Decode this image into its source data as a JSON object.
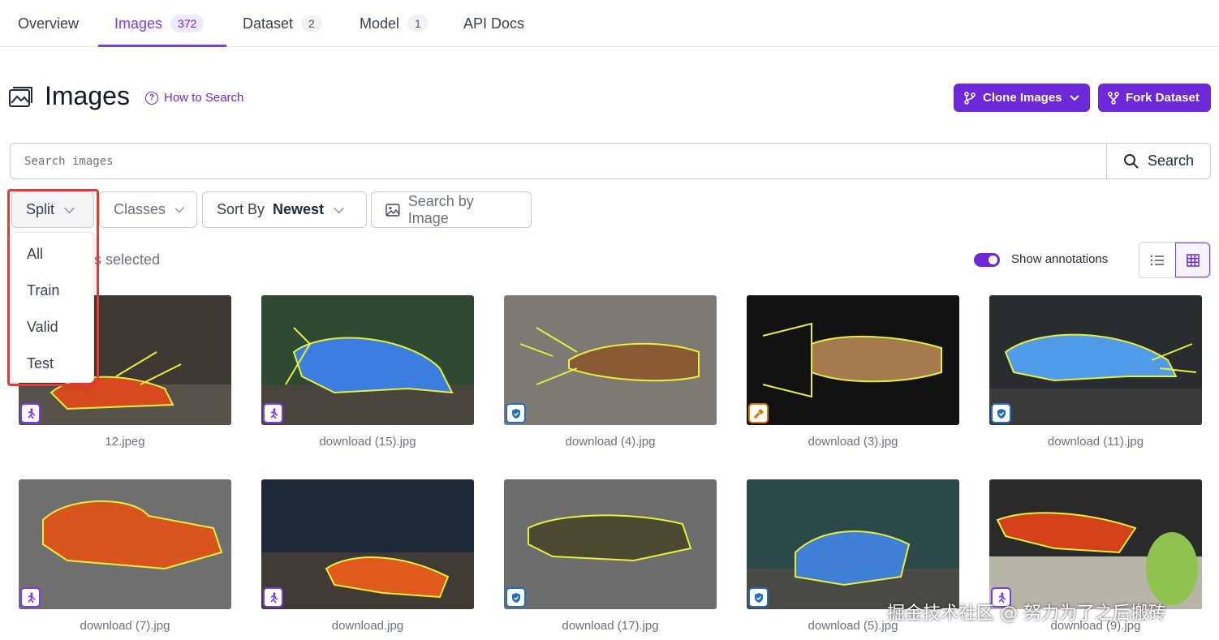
{
  "tabs": [
    {
      "label": "Overview",
      "count": ""
    },
    {
      "label": "Images",
      "count": "372"
    },
    {
      "label": "Dataset",
      "count": "2"
    },
    {
      "label": "Model",
      "count": "1"
    },
    {
      "label": "API Docs",
      "count": ""
    }
  ],
  "header": {
    "title": "Images",
    "how_to_search": "How to Search",
    "clone_label": "Clone Images",
    "fork_label": "Fork Dataset"
  },
  "search": {
    "placeholder": "Search images",
    "button_label": "Search"
  },
  "filters": {
    "split_label": "Split",
    "classes_label": "Classes",
    "sort_label": "Sort By",
    "sort_value": "Newest",
    "search_by_image": "Search by Image"
  },
  "split_dropdown": {
    "options": [
      "All",
      "Train",
      "Valid",
      "Test"
    ]
  },
  "selection": {
    "text": "s selected"
  },
  "view": {
    "annotations_label": "Show annotations"
  },
  "images": [
    {
      "filename": "12.jpeg",
      "split": "train"
    },
    {
      "filename": "download (15).jpg",
      "split": "train"
    },
    {
      "filename": "download (4).jpg",
      "split": "valid"
    },
    {
      "filename": "download (3).jpg",
      "split": "test"
    },
    {
      "filename": "download (11).jpg",
      "split": "valid"
    },
    {
      "filename": "download (7).jpg",
      "split": "train"
    },
    {
      "filename": "download.jpg",
      "split": "train"
    },
    {
      "filename": "download (17).jpg",
      "split": "valid"
    },
    {
      "filename": "download (5).jpg",
      "split": "valid"
    },
    {
      "filename": "download (9).jpg",
      "split": "train"
    }
  ],
  "watermark": "掘金技术社区 @ 努力为了之后搬砖",
  "colors": {
    "accent": "#6d28d9",
    "highlight": "#e53935",
    "annotation": "#e6f03c"
  }
}
